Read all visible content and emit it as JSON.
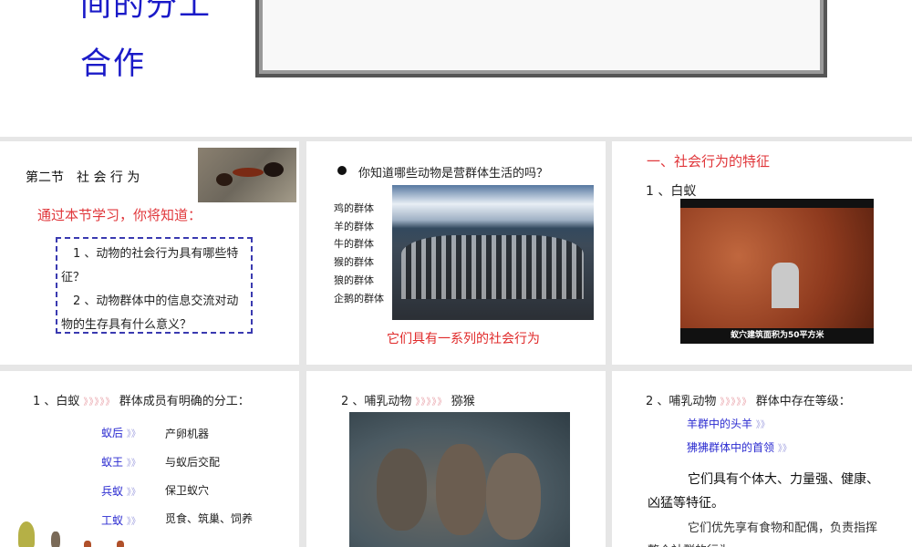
{
  "top_slide": {
    "title_line1": "间的分工",
    "title_line2": "合作"
  },
  "slides": [
    {
      "heading": "第二节　社 会 行 为",
      "subtitle": "通过本节学习，你将知道：",
      "q1": "　1 、动物的社会行为具有哪些特征？",
      "q2": "　2 、动物群体中的信息交流对动物的生存具有什么意义？",
      "image": "ants-photo"
    },
    {
      "question": "你知道哪些动物是营群体生活的吗？",
      "groups": [
        "鸡的群体",
        "羊的群体",
        "牛的群体",
        "猴的群体",
        "狼的群体",
        "企鹅的群体"
      ],
      "conclusion": "它们具有一系列的社会行为",
      "image": "penguins-photo"
    },
    {
      "heading": "一、社会行为的特征",
      "item": "1 、白蚁",
      "caption": "蚁穴建筑面积为50平方米",
      "image": "termite-mound-video"
    },
    {
      "line_a": "1 、白蚁",
      "chev": "》》》》》",
      "line_b": "群体成员有明确的分工：",
      "roles": [
        {
          "name": "蚁后",
          "duty": "产卵机器"
        },
        {
          "name": "蚁王",
          "duty": "与蚁后交配"
        },
        {
          "name": "兵蚁",
          "duty": "保卫蚁穴"
        },
        {
          "name": "工蚁",
          "duty": "觅食、筑巢、饲养"
        }
      ],
      "chev_small": "》》"
    },
    {
      "line_a": "2 、哺乳动物",
      "chev": "》》》》》",
      "line_b": "猕猴",
      "image": "macaques-video"
    },
    {
      "line_a": "2 、哺乳动物",
      "chev": "》》》》》",
      "line_b": "群体中存在等级：",
      "ranks": [
        "羊群中的头羊",
        "狒狒群体中的首领"
      ],
      "chev_small": "》》",
      "p1": "它们具有个体大、力量强、健康、凶猛等特征。",
      "p2": "它们优先享有食物和配偶，负责指挥整个社群的行为。"
    }
  ]
}
